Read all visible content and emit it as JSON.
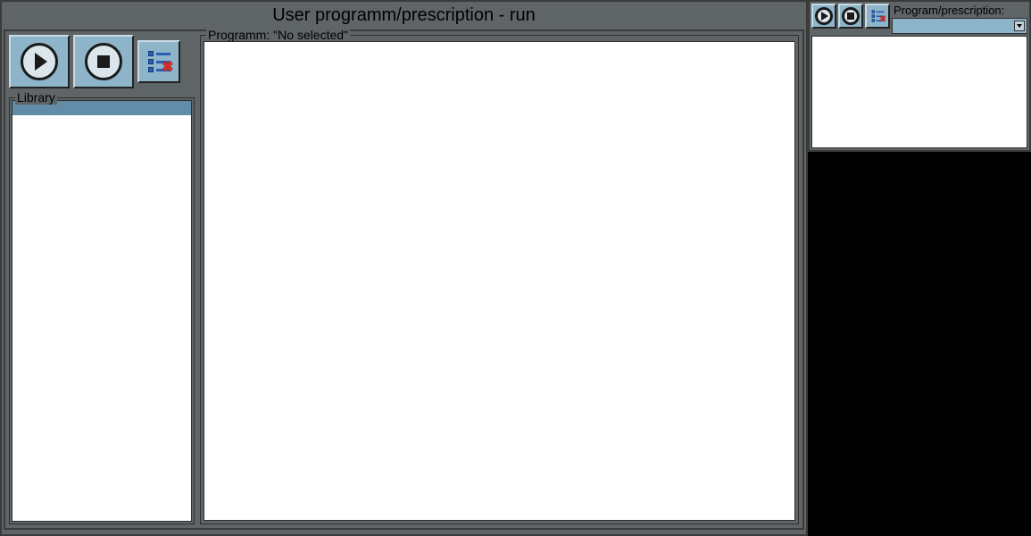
{
  "main": {
    "title": "User programm/prescription - run",
    "library_label": "Library",
    "program_label": "Programm: \"No selected\""
  },
  "mini": {
    "label": "Program/prescription:"
  }
}
